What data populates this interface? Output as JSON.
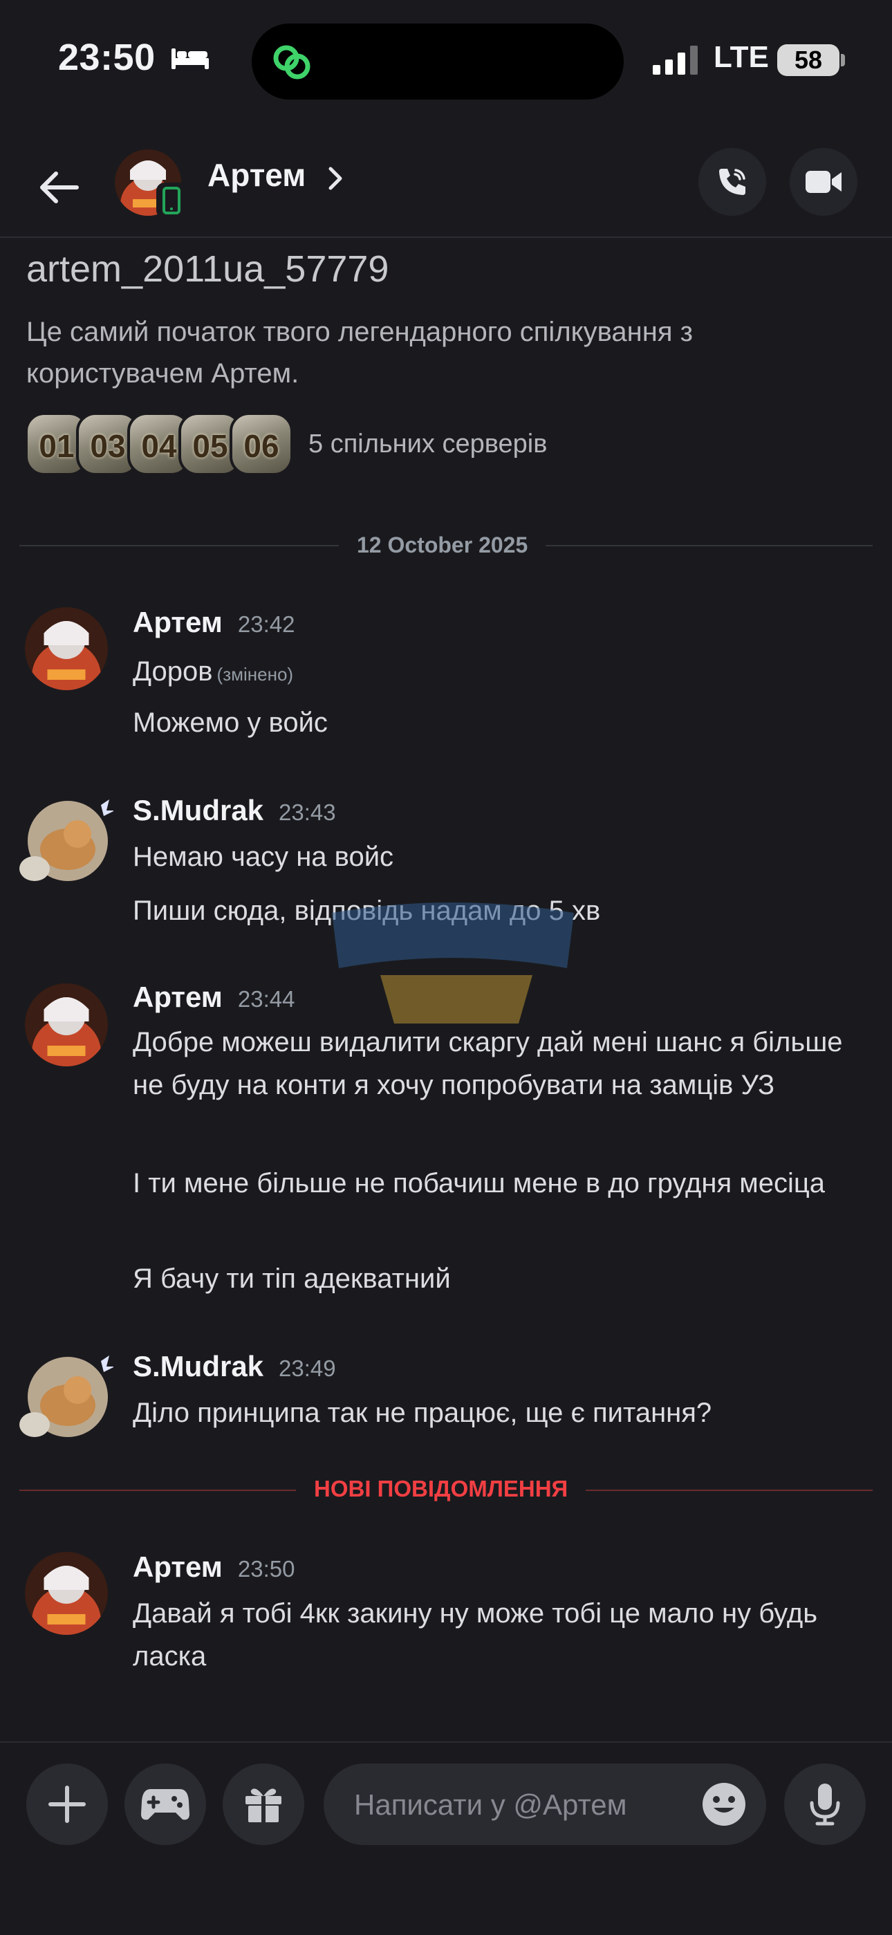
{
  "status_bar": {
    "time": "23:50",
    "network": "LTE",
    "battery": "58"
  },
  "header": {
    "name": "Артем",
    "chevron": "›"
  },
  "profile": {
    "username": "artem_2011ua_57779",
    "intro": "Це самий початок твого легендарного спілкування з користувачем Артем.",
    "server_icons": [
      "01",
      "03",
      "04",
      "05",
      "06"
    ],
    "mutual_servers": "5 спільних серверів"
  },
  "date_divider": "12 October 2025",
  "messages": [
    {
      "author": "Артем",
      "time": "23:42",
      "lines": [
        "Доров",
        "Можемо у войс"
      ],
      "edited": "(змінено)"
    },
    {
      "author": "S.Mudrak",
      "time": "23:43",
      "lines": [
        "Немаю часу на войс",
        "Пиши сюда, відповідь надам до 5 хв"
      ]
    },
    {
      "author": "Артем",
      "time": "23:44",
      "lines": [
        "Добре можеш видалити скаргу дай мені шанс я більше не буду на конти я хочу попробувати на замців УЗ",
        "І ти мене більше не побачиш мене в до грудня месіца",
        "Я бачу ти тіп адекватний"
      ]
    },
    {
      "author": "S.Mudrak",
      "time": "23:49",
      "lines": [
        "Діло принципа так не працює, ще є питання?"
      ]
    },
    {
      "author": "Артем",
      "time": "23:50",
      "lines": [
        "Давай я тобі 4кк закину ну може тобі це мало ну будь ласка"
      ]
    }
  ],
  "new_messages_divider": "НОВІ ПОВІДОМЛЕННЯ",
  "composer": {
    "placeholder": "Написати у @Артем"
  },
  "colors": {
    "background": "#1a1a1e",
    "new_messages_red": "#f23f43",
    "online_green": "#23a55a",
    "muted_text": "#949ba4"
  },
  "icons": [
    "back-arrow-icon",
    "phone-icon",
    "video-camera-icon",
    "plus-icon",
    "gamepad-icon",
    "gift-icon",
    "emoji-icon",
    "microphone-icon",
    "mobile-status-icon",
    "bed-icon",
    "signal-icon"
  ]
}
